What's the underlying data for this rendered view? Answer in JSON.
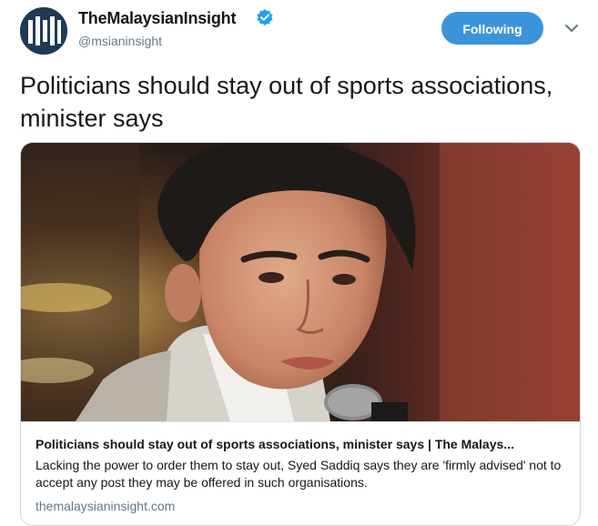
{
  "author": {
    "display_name": "TheMalaysianInsight",
    "handle": "@msianinsight",
    "verified": true
  },
  "follow_button": {
    "label": "Following"
  },
  "tweet": {
    "text": "Politicians should stay out of sports associations, minister says"
  },
  "card": {
    "title": "Politicians should stay out of sports associations, minister says | The Malays...",
    "description": "Lacking the power to order them to stay out, Syed Saddiq says they are 'firmly advised' not to accept any post they may be offered in such organisations.",
    "domain": "themalaysianinsight.com"
  },
  "colors": {
    "accent": "#3b94d9",
    "secondary_text": "#657786",
    "verified_badge": "#1da1f2"
  }
}
